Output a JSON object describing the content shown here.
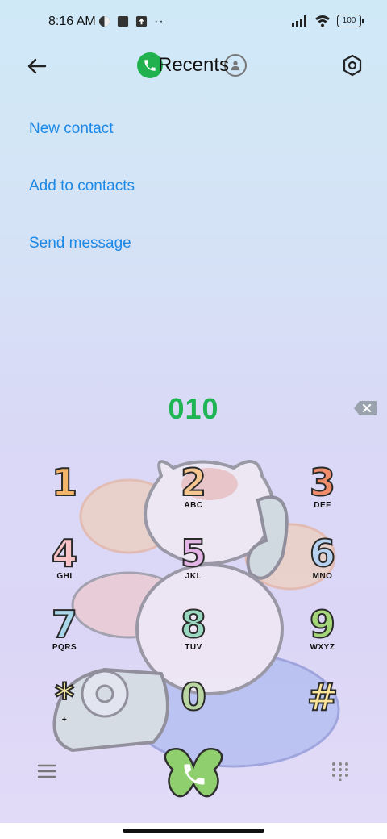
{
  "status_bar": {
    "time": "8:16 AM",
    "battery": "100"
  },
  "app_bar": {
    "title": "Recents"
  },
  "actions": {
    "new_contact": "New contact",
    "add_to_contacts": "Add to contacts",
    "send_message": "Send message"
  },
  "dialer": {
    "number": "010",
    "keys": [
      {
        "digit": "1",
        "letters": "",
        "color": "#f4b56b"
      },
      {
        "digit": "2",
        "letters": "ABC",
        "color": "#f6c690"
      },
      {
        "digit": "3",
        "letters": "DEF",
        "color": "#f08c6a"
      },
      {
        "digit": "4",
        "letters": "GHI",
        "color": "#f7c3c7"
      },
      {
        "digit": "5",
        "letters": "JKL",
        "color": "#e3b4e6"
      },
      {
        "digit": "6",
        "letters": "MNO",
        "color": "#b7d3f1"
      },
      {
        "digit": "7",
        "letters": "PQRS",
        "color": "#a9d6e9"
      },
      {
        "digit": "8",
        "letters": "TUV",
        "color": "#9ad8c2"
      },
      {
        "digit": "9",
        "letters": "WXYZ",
        "color": "#a4d679"
      },
      {
        "digit": "*",
        "letters": "+",
        "color": "#f3e7a0"
      },
      {
        "digit": "0",
        "letters": "",
        "color": "#b9d6a2"
      },
      {
        "digit": "#",
        "letters": "",
        "color": "#fde59a"
      }
    ]
  },
  "colors": {
    "accent_link": "#1e88e5",
    "number_green": "#1fb454",
    "call_green": "#8fcf6e"
  },
  "icons": [
    "back-arrow-icon",
    "phone-icon",
    "contact-icon",
    "settings-icon",
    "backspace-icon",
    "menu-icon",
    "call-icon",
    "dialpad-grid-icon"
  ]
}
